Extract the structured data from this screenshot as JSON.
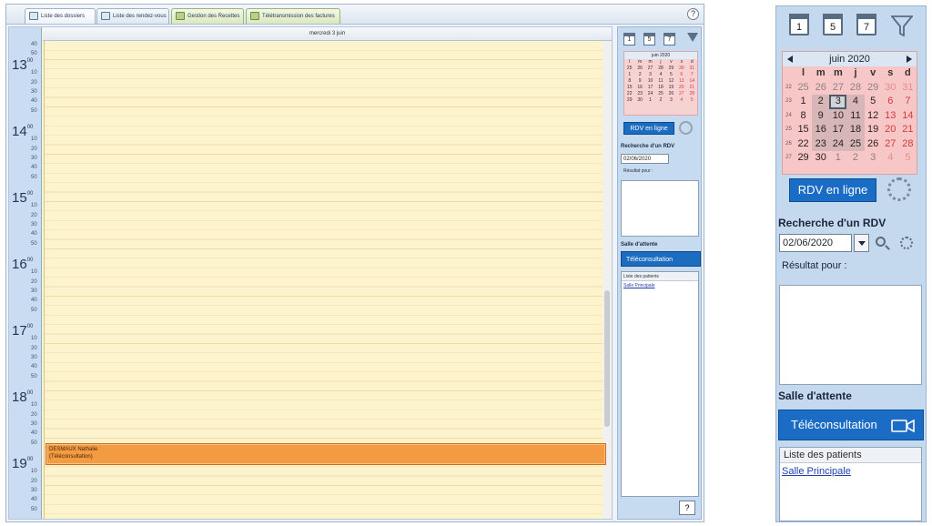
{
  "tabs": [
    {
      "label": "Liste des dossiers",
      "active": true
    },
    {
      "label": "Liste des rendez-vous",
      "active": false
    },
    {
      "label": "Gestion des Recettes",
      "active": false
    },
    {
      "label": "Télétransmission des factures",
      "active": false
    }
  ],
  "agenda": {
    "day_label": "mercredi 3 juin",
    "hour_suffix": "00",
    "hours": [
      "13",
      "14",
      "15",
      "16",
      "17",
      "18",
      "19"
    ],
    "minutes": [
      "10",
      "20",
      "30",
      "40",
      "50"
    ],
    "top_minutes": [
      "40",
      "50"
    ],
    "appointment": {
      "name": "DESMAUX Nathalie",
      "type": "(Téléconsultation)",
      "color": "#f29b43"
    }
  },
  "panel": {
    "view_icons": [
      {
        "name": "day-view-icon",
        "label": "1"
      },
      {
        "name": "week5-view-icon",
        "label": "5"
      },
      {
        "name": "week7-view-icon",
        "label": "7"
      }
    ],
    "filter_icon": "filter-icon",
    "calendar": {
      "month": "juin 2020",
      "day_headers": [
        "l",
        "m",
        "m",
        "j",
        "v",
        "s",
        "d"
      ],
      "weeks": [
        {
          "wk": "22",
          "days": [
            "25",
            "26",
            "27",
            "28",
            "29",
            "30",
            "31"
          ]
        },
        {
          "wk": "23",
          "days": [
            "1",
            "2",
            "3",
            "4",
            "5",
            "6",
            "7"
          ]
        },
        {
          "wk": "24",
          "days": [
            "8",
            "9",
            "10",
            "11",
            "12",
            "13",
            "14"
          ]
        },
        {
          "wk": "25",
          "days": [
            "15",
            "16",
            "17",
            "18",
            "19",
            "20",
            "21"
          ]
        },
        {
          "wk": "26",
          "days": [
            "22",
            "23",
            "24",
            "25",
            "26",
            "27",
            "28"
          ]
        },
        {
          "wk": "27",
          "days": [
            "29",
            "30",
            "1",
            "2",
            "3",
            "4",
            "5"
          ]
        }
      ],
      "today": "3",
      "weekend_color": "#d63a3a"
    },
    "rdv_button": "RDV en ligne",
    "search_title": "Recherche d'un RDV",
    "date_value": "02/06/2020",
    "result_label": "Résultat pour :",
    "salle_title": "Salle d'attente",
    "tele_button": "Téléconsultation",
    "patients_header": "Liste des patients",
    "patients": [
      "Salle Principale"
    ],
    "help": "?"
  },
  "colors": {
    "accent_blue": "#1a6cc4",
    "agenda_bg": "#fdf3cc",
    "calendar_bg": "#f7c7c8"
  }
}
